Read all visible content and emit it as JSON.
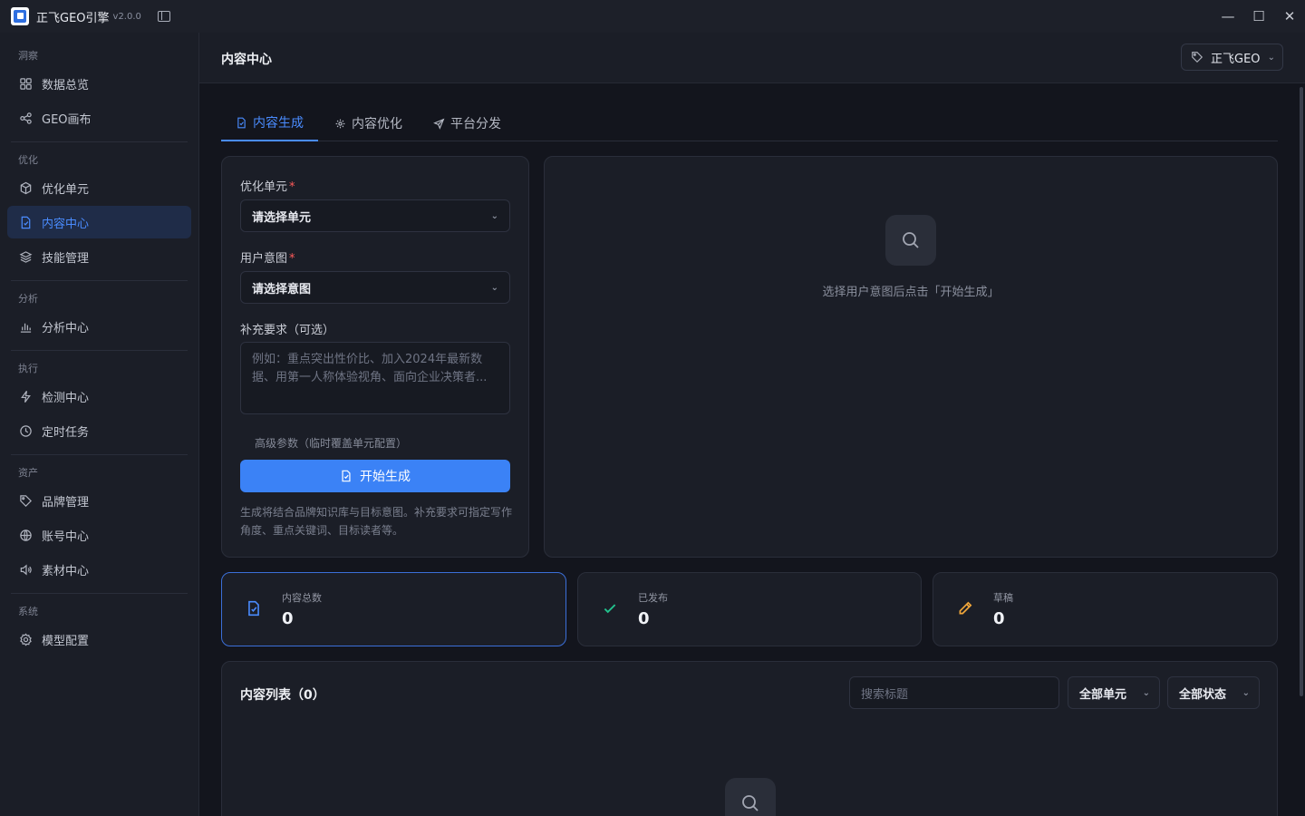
{
  "titlebar": {
    "app_title": "正飞GEO引擎",
    "version": "v2.0.0"
  },
  "sidebar": {
    "sections": [
      {
        "label": "洞察",
        "items": [
          {
            "label": "数据总览",
            "icon": "grid-icon"
          },
          {
            "label": "GEO画布",
            "icon": "share-nodes-icon"
          }
        ]
      },
      {
        "label": "优化",
        "items": [
          {
            "label": "优化单元",
            "icon": "cube-icon"
          },
          {
            "label": "内容中心",
            "icon": "document-icon",
            "active": true
          },
          {
            "label": "技能管理",
            "icon": "layers-icon"
          }
        ]
      },
      {
        "label": "分析",
        "items": [
          {
            "label": "分析中心",
            "icon": "bar-chart-icon"
          }
        ]
      },
      {
        "label": "执行",
        "items": [
          {
            "label": "检测中心",
            "icon": "lightning-icon"
          },
          {
            "label": "定时任务",
            "icon": "clock-icon"
          }
        ]
      },
      {
        "label": "资产",
        "items": [
          {
            "label": "品牌管理",
            "icon": "tag-icon"
          },
          {
            "label": "账号中心",
            "icon": "globe-icon"
          },
          {
            "label": "素材中心",
            "icon": "speaker-icon"
          }
        ]
      },
      {
        "label": "系统",
        "items": [
          {
            "label": "模型配置",
            "icon": "gear-icon"
          }
        ]
      }
    ]
  },
  "header": {
    "title": "内容中心",
    "brand": "正飞GEO"
  },
  "tabs": [
    {
      "label": "内容生成",
      "active": true
    },
    {
      "label": "内容优化"
    },
    {
      "label": "平台分发"
    }
  ],
  "form": {
    "unit_label": "优化单元",
    "unit_value": "请选择单元",
    "intent_label": "用户意图",
    "intent_value": "请选择意图",
    "extra_label": "补充要求（可选）",
    "extra_placeholder": "例如：重点突出性价比、加入2024年最新数据、用第一人称体验视角、面向企业决策者...",
    "advanced": "高级参数（临时覆盖单元配置）",
    "generate_button": "开始生成",
    "hint": "生成将结合品牌知识库与目标意图。补充要求可指定写作角度、重点关键词、目标读者等。"
  },
  "preview": {
    "empty_text": "选择用户意图后点击「开始生成」"
  },
  "stats": [
    {
      "label": "内容总数",
      "value": "0",
      "icon": "document-check-icon",
      "color": "#4a8cff"
    },
    {
      "label": "已发布",
      "value": "0",
      "icon": "check-icon",
      "color": "#22c38e"
    },
    {
      "label": "草稿",
      "value": "0",
      "icon": "pencil-icon",
      "color": "#f0a63a"
    }
  ],
  "list": {
    "title": "内容列表（0）",
    "search_placeholder": "搜索标题",
    "unit_filter": "全部单元",
    "status_filter": "全部状态"
  }
}
